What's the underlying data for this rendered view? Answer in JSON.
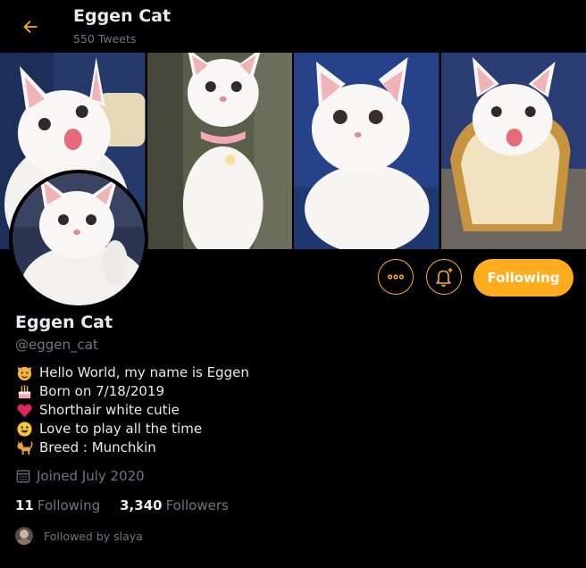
{
  "header": {
    "title": "Eggen Cat",
    "tweet_count": "550 Tweets"
  },
  "banner": {
    "panels": [
      "kitten-sitting-tongue",
      "kitten-pink-collar",
      "kitten-lying-face",
      "kitten-bread-costume"
    ]
  },
  "actions": {
    "follow_label": "Following",
    "more_icon": "more-options-icon",
    "bell_icon": "notification-bell-icon"
  },
  "profile": {
    "name": "Eggen Cat",
    "handle": "@eggen_cat",
    "bio": [
      {
        "icon": "cat-face-icon",
        "text": "Hello World, my name is Eggen"
      },
      {
        "icon": "birthday-cake-icon",
        "text": "Born on 7/18/2019"
      },
      {
        "icon": "heart-icon",
        "text": "Shorthair white cutie"
      },
      {
        "icon": "smiley-face-icon",
        "text": "Love to play all the time"
      },
      {
        "icon": "cat-icon",
        "text": "Breed : Munchkin"
      }
    ],
    "joined": "Joined July 2020",
    "following_count": "11",
    "following_label": "Following",
    "followers_count": "3,340",
    "followers_label": "Followers",
    "followed_by": "Followed by slaya"
  },
  "colors": {
    "accent": "#ffad1f",
    "background": "#000000",
    "text_primary": "#e7e9ea",
    "text_secondary": "#6e767d"
  }
}
